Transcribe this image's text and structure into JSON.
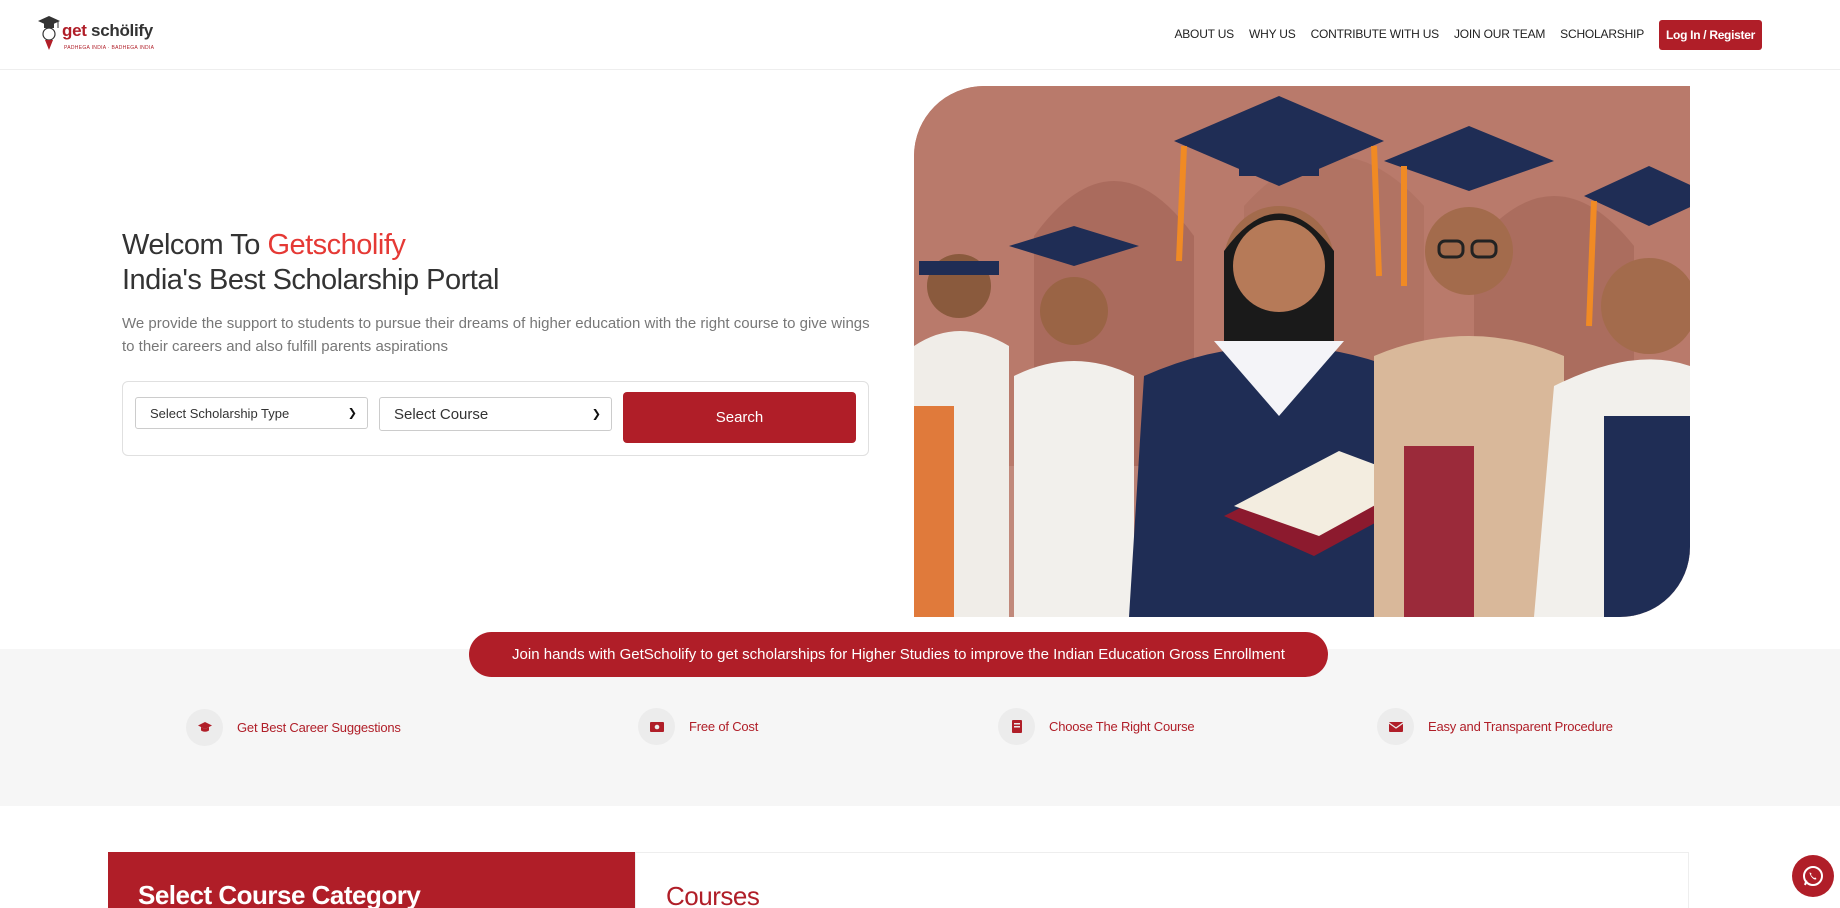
{
  "header": {
    "logo": {
      "brand_prefix": "get",
      "brand_suffix": "schölify",
      "tagline": "PADHEGA INDIA · BADHEGA INDIA"
    },
    "nav": [
      "ABOUT US",
      "WHY US",
      "CONTRIBUTE WITH US",
      "JOIN OUR TEAM",
      "SCHOLARSHIP"
    ],
    "login_label": "Log In / Register"
  },
  "hero": {
    "title_prefix": "Welcom To ",
    "title_accent": "Getscholify",
    "title_line2": "India's Best Scholarship Portal",
    "description": "We provide the support to students to pursue their dreams of higher education with the right course to give wings to their careers and also fulfill parents aspirations",
    "search": {
      "scholarship_type": "Select Scholarship Type",
      "course": "Select Course",
      "button": "Search"
    }
  },
  "banner": "Join hands with GetScholify to get scholarships for Higher Studies to improve the Indian Education Gross Enrollment",
  "features": [
    {
      "label": "Get Best Career Suggestions",
      "icon": "graduation-cap-icon"
    },
    {
      "label": "Free of Cost",
      "icon": "money-icon"
    },
    {
      "label": "Choose The Right Course",
      "icon": "book-icon"
    },
    {
      "label": "Easy and Transparent Procedure",
      "icon": "envelope-icon"
    }
  ],
  "courses": {
    "left_title": "Select Course Category",
    "right_title": "Courses"
  },
  "colors": {
    "brand": "#b01e28",
    "accent": "#e53935",
    "band_bg": "#f6f6f6"
  }
}
